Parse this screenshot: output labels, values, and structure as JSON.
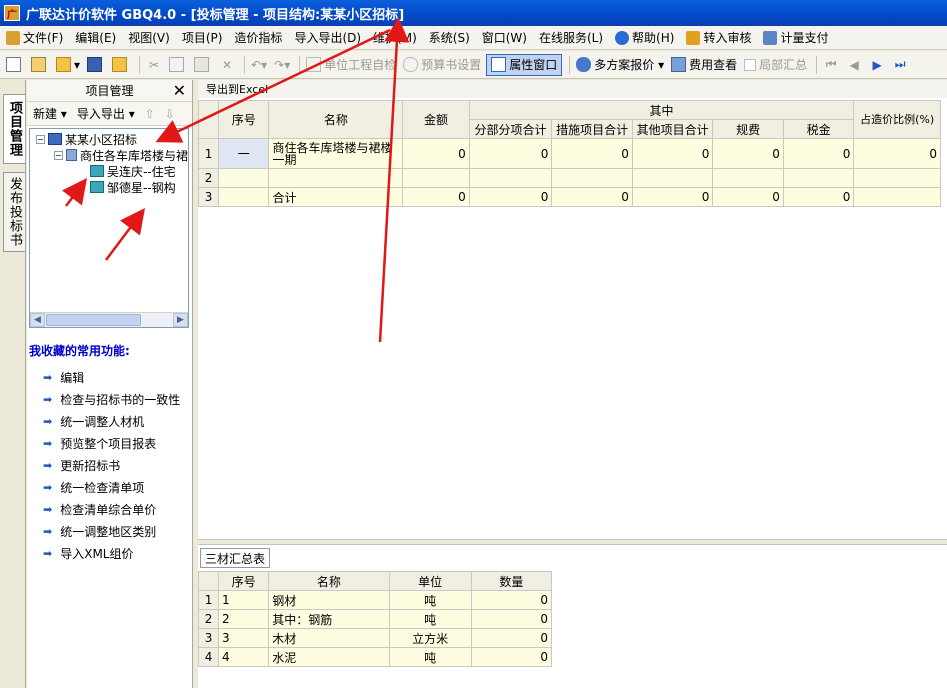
{
  "window": {
    "title": "广联达计价软件 GBQ4.0 - [投标管理 - 项目结构:某某小区招标]"
  },
  "menu": [
    {
      "label": "文件(F)",
      "icon": "app-icon"
    },
    {
      "label": "编辑(E)"
    },
    {
      "label": "视图(V)"
    },
    {
      "label": "项目(P)"
    },
    {
      "label": "造价指标"
    },
    {
      "label": "导入导出(D)"
    },
    {
      "label": "维护(M)"
    },
    {
      "label": "系统(S)"
    },
    {
      "label": "窗口(W)"
    },
    {
      "label": "在线服务(L)"
    },
    {
      "label": "帮助(H)",
      "icon": "help-icon"
    },
    {
      "label": "转入审核",
      "icon": "review-icon"
    },
    {
      "label": "计量支付",
      "icon": "payment-icon"
    }
  ],
  "toolbar": {
    "unit_check": "单位工程自检",
    "budget_setting": "预算书设置",
    "property_window": "属性窗口",
    "multi_plan": "多方案报价",
    "fee_view": "费用查看",
    "partial_summary": "局部汇总"
  },
  "vtabs": {
    "project_mgmt": "项目管理",
    "publish_bid": "发布投标书"
  },
  "left_pane": {
    "title": "项目管理",
    "new_label": "新建",
    "import_export_label": "导入导出",
    "tree": {
      "root": "某某小区招标",
      "child": "商住各车库塔楼与裙",
      "leaves": [
        "吴连庆--住宅",
        "邹德星--钢构"
      ]
    },
    "favorites_title": "我收藏的常用功能:",
    "favorites": [
      "编辑",
      "检查与招标书的一致性",
      "统一调整人材机",
      "预览整个项目报表",
      "更新招标书",
      "统一检查清单项",
      "检查清单综合单价",
      "统一调整地区类别",
      "导入XML组价"
    ]
  },
  "main": {
    "export_label": "导出到Excel",
    "columns": {
      "seq": "序号",
      "name": "名称",
      "amount": "金额",
      "among": "其中",
      "ratio": "占造价比例(%)",
      "sub": [
        "分部分项合计",
        "措施项目合计",
        "其他项目合计",
        "规费",
        "税金"
      ]
    },
    "rows": [
      {
        "num": "1",
        "seq": "一",
        "name": "商住各车库塔楼与裙楼一期",
        "amount": "0",
        "sub": [
          "0",
          "0",
          "0",
          "0",
          "0"
        ],
        "ratio": "0"
      },
      {
        "num": "2",
        "seq": "",
        "name": "",
        "amount": "",
        "sub": [
          "",
          "",
          "",
          "",
          ""
        ],
        "ratio": ""
      },
      {
        "num": "3",
        "seq": "",
        "name": "合计",
        "amount": "0",
        "sub": [
          "0",
          "0",
          "0",
          "0",
          "0"
        ],
        "ratio": ""
      }
    ],
    "bottom_tab": "三材汇总表",
    "materials_columns": {
      "seq": "序号",
      "name": "名称",
      "unit": "单位",
      "qty": "数量"
    },
    "materials": [
      {
        "num": "1",
        "seq": "1",
        "name": "钢材",
        "unit": "吨",
        "qty": "0"
      },
      {
        "num": "2",
        "seq": "2",
        "name": "其中：钢筋",
        "unit": "吨",
        "qty": "0"
      },
      {
        "num": "3",
        "seq": "3",
        "name": "木材",
        "unit": "立方米",
        "qty": "0"
      },
      {
        "num": "4",
        "seq": "4",
        "name": "水泥",
        "unit": "吨",
        "qty": "0"
      }
    ]
  }
}
